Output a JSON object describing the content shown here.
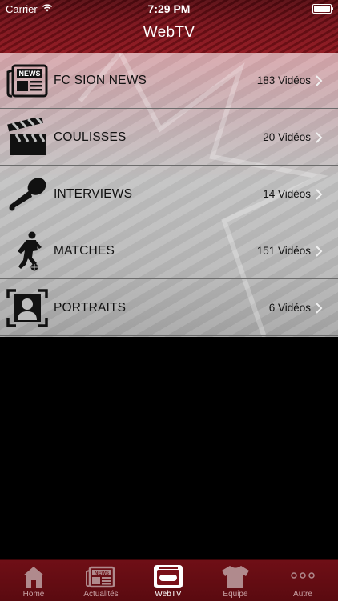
{
  "status_bar": {
    "carrier": "Carrier",
    "time": "7:29 PM"
  },
  "nav": {
    "title": "WebTV"
  },
  "categories": [
    {
      "label": "FC SION NEWS",
      "count": "183 Vidéos",
      "icon": "newspaper-icon"
    },
    {
      "label": "COULISSES",
      "count": "20 Vidéos",
      "icon": "clapperboard-icon"
    },
    {
      "label": "INTERVIEWS",
      "count": "14 Vidéos",
      "icon": "microphone-icon"
    },
    {
      "label": "MATCHES",
      "count": "151 Vidéos",
      "icon": "football-player-icon"
    },
    {
      "label": "PORTRAITS",
      "count": "6 Vidéos",
      "icon": "portrait-frame-icon"
    }
  ],
  "tabbar": {
    "active": "WebTV",
    "tabs": [
      {
        "label": "Home",
        "icon": "home-icon"
      },
      {
        "label": "Actualités",
        "icon": "news-icon"
      },
      {
        "label": "WebTV",
        "icon": "tv-icon"
      },
      {
        "label": "Equipe",
        "icon": "jersey-icon"
      },
      {
        "label": "Autre",
        "icon": "more-dots-icon"
      }
    ]
  },
  "colors": {
    "header": "#7a1119",
    "tabbar": "#5a0a10",
    "list_text": "#111111"
  }
}
